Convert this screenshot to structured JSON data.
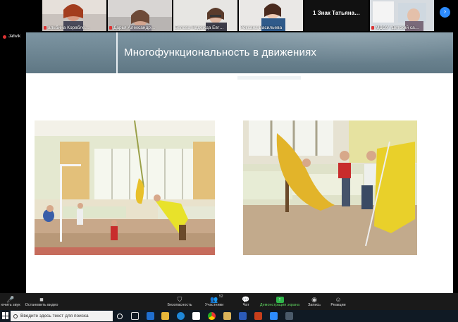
{
  "participants": [
    {
      "name": "альбина Корабле…",
      "muted": true,
      "kind": "video"
    },
    {
      "name": "Дарья Александр…",
      "muted": true,
      "kind": "video"
    },
    {
      "name": "Белова Надежда Евг…",
      "muted": false,
      "kind": "video"
    },
    {
      "name": "Роксана Васильева",
      "muted": false,
      "kind": "video"
    },
    {
      "name": "1 Знак Татьяна…",
      "muted": false,
      "kind": "name-only"
    },
    {
      "name": "МДОУ \"Детский са…",
      "muted": true,
      "kind": "video"
    }
  ],
  "speaker": {
    "name": "Jahvik"
  },
  "slide": {
    "title": "Многофункциональность в движениях"
  },
  "toolbar": {
    "unmute": "ючить звук",
    "stop_video": "Остановить видео",
    "security": "Безопасность",
    "participants": "Участники",
    "participants_count": "52",
    "chat": "Чат",
    "share_screen": "Демонстрация экрана",
    "record": "Запись",
    "reactions": "Реакции"
  },
  "taskbar": {
    "search_placeholder": "Введите здесь текст для поиска"
  },
  "colors": {
    "slide_header": "#6d8693",
    "zoom_blue": "#2d8cff",
    "share_green": "#2fb54a"
  }
}
